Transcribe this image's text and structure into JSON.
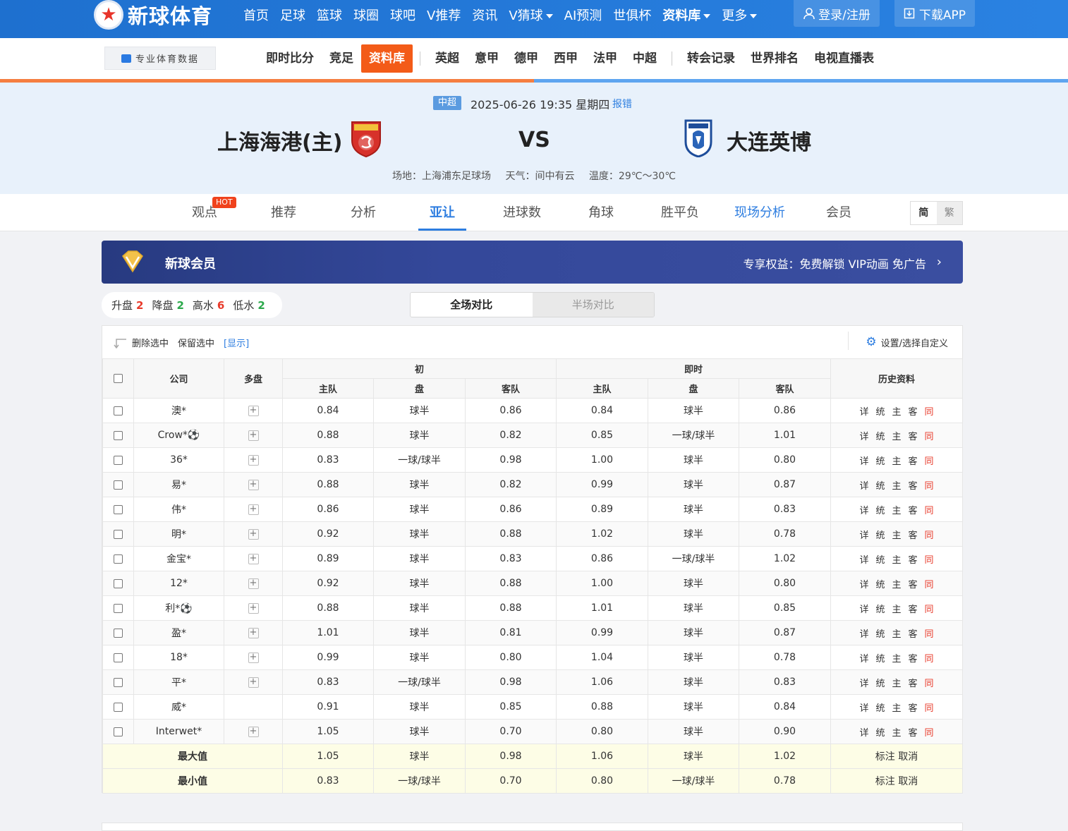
{
  "topnav": {
    "logo_text": "新球体育",
    "items": [
      "首页",
      "足球",
      "篮球",
      "球圈",
      "球吧",
      "V推荐",
      "资讯",
      "V猜球",
      "AI预测",
      "世俱杯",
      "资料库",
      "更多"
    ],
    "login": "登录/注册",
    "download": "下载APP"
  },
  "subnav": {
    "brand": "专业体育数据",
    "items": [
      "即时比分",
      "竞足",
      "资料库",
      "英超",
      "意甲",
      "德甲",
      "西甲",
      "法甲",
      "中超",
      "转会记录",
      "世界排名",
      "电视直播表"
    ]
  },
  "match": {
    "league": "中超",
    "datetime": "2025-06-26 19:35 星期四",
    "report": "报错",
    "home": "上海海港(主)",
    "vs": "VS",
    "away": "大连英博",
    "venue": "场地：上海浦东足球场",
    "weather": "天气：间中有云",
    "temp": "温度：29℃～30℃"
  },
  "tabs": {
    "items": [
      "观点",
      "推荐",
      "分析",
      "亚让",
      "进球数",
      "角球",
      "胜平负",
      "现场分析",
      "会员"
    ],
    "hot": "HOT",
    "lang_simp": "简",
    "lang_trad": "繁"
  },
  "vip": {
    "title": "新球会员",
    "promo": "专享权益：免费解锁 VIP动画 免广告"
  },
  "stats": {
    "up_label": "升盘",
    "up": "2",
    "down_label": "降盘",
    "down": "2",
    "high_label": "高水",
    "high": "6",
    "low_label": "低水",
    "low": "2"
  },
  "compare": {
    "full": "全场对比",
    "half": "半场对比"
  },
  "toolbar": {
    "delete": "删除选中",
    "keep": "保留选中",
    "show": "[显示]",
    "settings": "设置/选择自定义"
  },
  "table": {
    "headers": {
      "company": "公司",
      "multi": "多盘",
      "initial": "初",
      "live": "即时",
      "history": "历史资料",
      "home": "主队",
      "line": "盘",
      "away": "客队"
    },
    "history_links": [
      "详",
      "统",
      "主",
      "客",
      "同"
    ],
    "rows": [
      {
        "company": "澳*",
        "plus": true,
        "i_home": "0.84",
        "i_line": "球半",
        "i_away": "0.86",
        "l_home": "0.84",
        "l_line": "球半",
        "l_away": "0.86"
      },
      {
        "company": "Crow*⚽",
        "plus": true,
        "i_home": "0.88",
        "i_line": "球半",
        "i_away": "0.82",
        "l_home": "0.85",
        "l_line": "一球/球半",
        "l_away": "1.01"
      },
      {
        "company": "36*",
        "plus": true,
        "i_home": "0.83",
        "i_line": "一球/球半",
        "i_away": "0.98",
        "l_home": "1.00",
        "l_line": "球半",
        "l_away": "0.80"
      },
      {
        "company": "易*",
        "plus": true,
        "i_home": "0.88",
        "i_line": "球半",
        "i_away": "0.82",
        "l_home": "0.99",
        "l_line": "球半",
        "l_away": "0.87"
      },
      {
        "company": "伟*",
        "plus": true,
        "i_home": "0.86",
        "i_line": "球半",
        "i_away": "0.86",
        "l_home": "0.89",
        "l_line": "球半",
        "l_away": "0.83"
      },
      {
        "company": "明*",
        "plus": true,
        "i_home": "0.92",
        "i_line": "球半",
        "i_away": "0.88",
        "l_home": "1.02",
        "l_line": "球半",
        "l_away": "0.78"
      },
      {
        "company": "金宝*",
        "plus": true,
        "i_home": "0.89",
        "i_line": "球半",
        "i_away": "0.83",
        "l_home": "0.86",
        "l_line": "一球/球半",
        "l_away": "1.02"
      },
      {
        "company": "12*",
        "plus": true,
        "i_home": "0.92",
        "i_line": "球半",
        "i_away": "0.88",
        "l_home": "1.00",
        "l_line": "球半",
        "l_away": "0.80"
      },
      {
        "company": "利*⚽",
        "plus": true,
        "i_home": "0.88",
        "i_line": "球半",
        "i_away": "0.88",
        "l_home": "1.01",
        "l_line": "球半",
        "l_away": "0.85"
      },
      {
        "company": "盈*",
        "plus": true,
        "i_home": "1.01",
        "i_line": "球半",
        "i_away": "0.81",
        "l_home": "0.99",
        "l_line": "球半",
        "l_away": "0.87"
      },
      {
        "company": "18*",
        "plus": true,
        "i_home": "0.99",
        "i_line": "球半",
        "i_away": "0.80",
        "l_home": "1.04",
        "l_line": "球半",
        "l_away": "0.78"
      },
      {
        "company": "平*",
        "plus": true,
        "i_home": "0.83",
        "i_line": "一球/球半",
        "i_away": "0.98",
        "l_home": "1.06",
        "l_line": "球半",
        "l_away": "0.83"
      },
      {
        "company": "威*",
        "plus": false,
        "i_home": "0.91",
        "i_line": "球半",
        "i_away": "0.85",
        "l_home": "0.88",
        "l_line": "球半",
        "l_away": "0.84"
      },
      {
        "company": "Interwet*",
        "plus": true,
        "i_home": "1.05",
        "i_line": "球半",
        "i_away": "0.70",
        "l_home": "0.80",
        "l_line": "球半",
        "l_away": "0.90"
      }
    ],
    "max": {
      "label": "最大值",
      "i_home": "1.05",
      "i_line": "球半",
      "i_away": "0.98",
      "l_home": "1.06",
      "l_line": "球半",
      "l_away": "1.02",
      "action": "标注 取消"
    },
    "min": {
      "label": "最小值",
      "i_home": "0.83",
      "i_line": "一球/球半",
      "i_away": "0.70",
      "l_home": "0.80",
      "l_line": "一球/球半",
      "l_away": "0.78",
      "action": "标注 取消"
    }
  }
}
